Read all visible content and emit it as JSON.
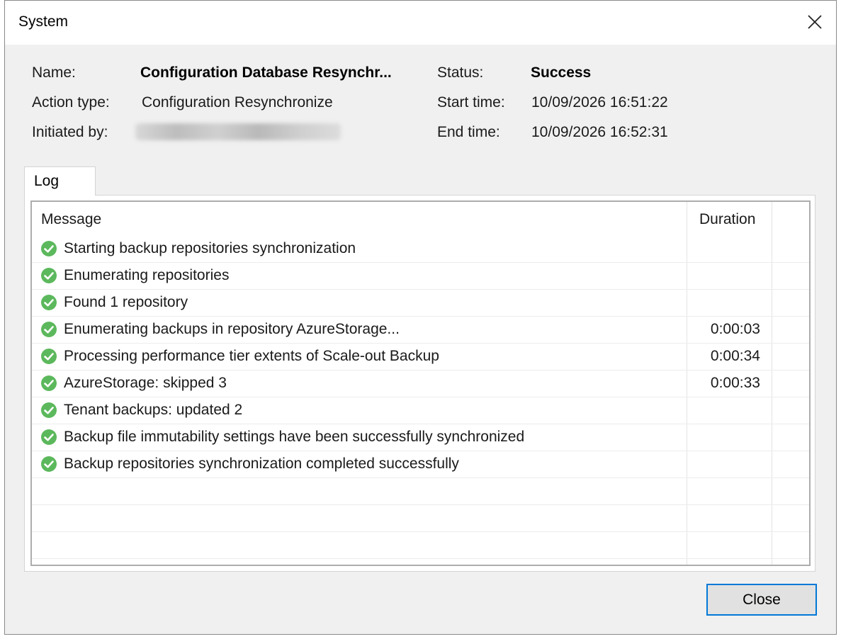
{
  "window": {
    "title": "System"
  },
  "summary": {
    "name_label": "Name:",
    "name_value": "Configuration Database Resynchr...",
    "action_type_label": "Action type:",
    "action_type_value": "Configuration Resynchronize",
    "initiated_by_label": "Initiated by:",
    "status_label": "Status:",
    "status_value": "Success",
    "start_time_label": "Start time:",
    "start_time_value": "10/09/2026 16:51:22",
    "end_time_label": "End time:",
    "end_time_value": "10/09/2026 16:52:31"
  },
  "tabs": [
    {
      "label": "Log",
      "selected": true
    }
  ],
  "log": {
    "columns": {
      "message": "Message",
      "duration": "Duration"
    },
    "rows": [
      {
        "status": "success",
        "message": "Starting backup repositories synchronization",
        "duration": ""
      },
      {
        "status": "success",
        "message": "Enumerating repositories",
        "duration": ""
      },
      {
        "status": "success",
        "message": "Found 1 repository",
        "duration": ""
      },
      {
        "status": "success",
        "message": "Enumerating backups in repository AzureStorage...",
        "duration": "0:00:03"
      },
      {
        "status": "success",
        "message": "Processing performance tier extents of Scale-out Backup",
        "duration": "0:00:34"
      },
      {
        "status": "success",
        "message": "AzureStorage: skipped 3",
        "duration": "0:00:33"
      },
      {
        "status": "success",
        "message": "Tenant backups: updated 2",
        "duration": ""
      },
      {
        "status": "success",
        "message": "Backup file immutability settings have been successfully synchronized",
        "duration": ""
      },
      {
        "status": "success",
        "message": "Backup repositories synchronization completed successfully",
        "duration": ""
      }
    ],
    "empty_rows": 3
  },
  "footer": {
    "close_label": "Close"
  },
  "colors": {
    "success_icon": "#5cb85c",
    "button_focus_border": "#0078d7",
    "dialog_background": "#f0f0f0"
  },
  "icons": {
    "close": "close-icon",
    "row_status": "success-check-icon"
  }
}
